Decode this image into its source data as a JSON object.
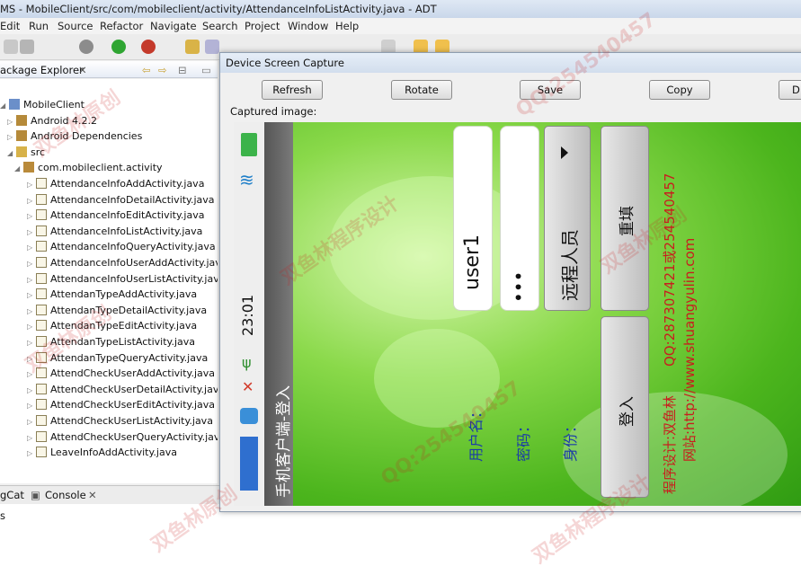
{
  "window": {
    "title": "MS - MobileClient/src/com/mobileclient/activity/AttendanceInfoListActivity.java - ADT"
  },
  "menu": [
    "Edit",
    "Run",
    "Source",
    "Refactor",
    "Navigate",
    "Search",
    "Project",
    "Window",
    "Help"
  ],
  "package_explorer": {
    "tab_label": "ackage Explorer",
    "items": [
      {
        "label": "MobileClient",
        "kind": "project"
      },
      {
        "label": "Android 4.2.2",
        "kind": "lib"
      },
      {
        "label": "Android Dependencies",
        "kind": "lib"
      },
      {
        "label": "src",
        "kind": "folder"
      },
      {
        "label": "com.mobileclient.activity",
        "kind": "package"
      },
      {
        "label": "AttendanceInfoAddActivity.java",
        "kind": "file"
      },
      {
        "label": "AttendanceInfoDetailActivity.java",
        "kind": "file"
      },
      {
        "label": "AttendanceInfoEditActivity.java",
        "kind": "file"
      },
      {
        "label": "AttendanceInfoListActivity.java",
        "kind": "file"
      },
      {
        "label": "AttendanceInfoQueryActivity.java",
        "kind": "file"
      },
      {
        "label": "AttendanceInfoUserAddActivity.java",
        "kind": "file"
      },
      {
        "label": "AttendanceInfoUserListActivity.java",
        "kind": "file"
      },
      {
        "label": "AttendanTypeAddActivity.java",
        "kind": "file"
      },
      {
        "label": "AttendanTypeDetailActivity.java",
        "kind": "file"
      },
      {
        "label": "AttendanTypeEditActivity.java",
        "kind": "file"
      },
      {
        "label": "AttendanTypeListActivity.java",
        "kind": "file"
      },
      {
        "label": "AttendanTypeQueryActivity.java",
        "kind": "file"
      },
      {
        "label": "AttendCheckUserAddActivity.java",
        "kind": "file"
      },
      {
        "label": "AttendCheckUserDetailActivity.java",
        "kind": "file"
      },
      {
        "label": "AttendCheckUserEditActivity.java",
        "kind": "file"
      },
      {
        "label": "AttendCheckUserListActivity.java",
        "kind": "file"
      },
      {
        "label": "AttendCheckUserQueryActivity.java",
        "kind": "file"
      },
      {
        "label": "LeaveInfoAddActivity.java",
        "kind": "file"
      }
    ]
  },
  "bottom_tabs": {
    "logcat": "gCat",
    "console": "Console",
    "sidebar_letter": "s"
  },
  "dialog": {
    "title": "Device Screen Capture",
    "buttons": {
      "refresh": "Refresh",
      "rotate": "Rotate",
      "save": "Save",
      "copy": "Copy",
      "done": "D"
    },
    "captured_label": "Captured image:"
  },
  "device": {
    "time": "23:01",
    "app_title": "手机客户端-登入",
    "username_label": "用户名：",
    "password_label": "密码：",
    "role_label": "身份：",
    "username_value": "user1",
    "password_value": "•••",
    "role_value": "远程人员",
    "reset_button": "重填",
    "login_button": "登入",
    "credit_designer": "程序设计:双鱼林",
    "credit_qq": "QQ:287307421或254540457",
    "credit_site": "网站:http://www.shuangyulin.com"
  },
  "watermarks": [
    "双鱼林原创",
    "QQ:254540457",
    "双鱼林程序设计",
    "双鱼林原创",
    "QQ:254540457",
    "双鱼林原创",
    "双鱼林程序设计",
    "双鱼林原创"
  ]
}
